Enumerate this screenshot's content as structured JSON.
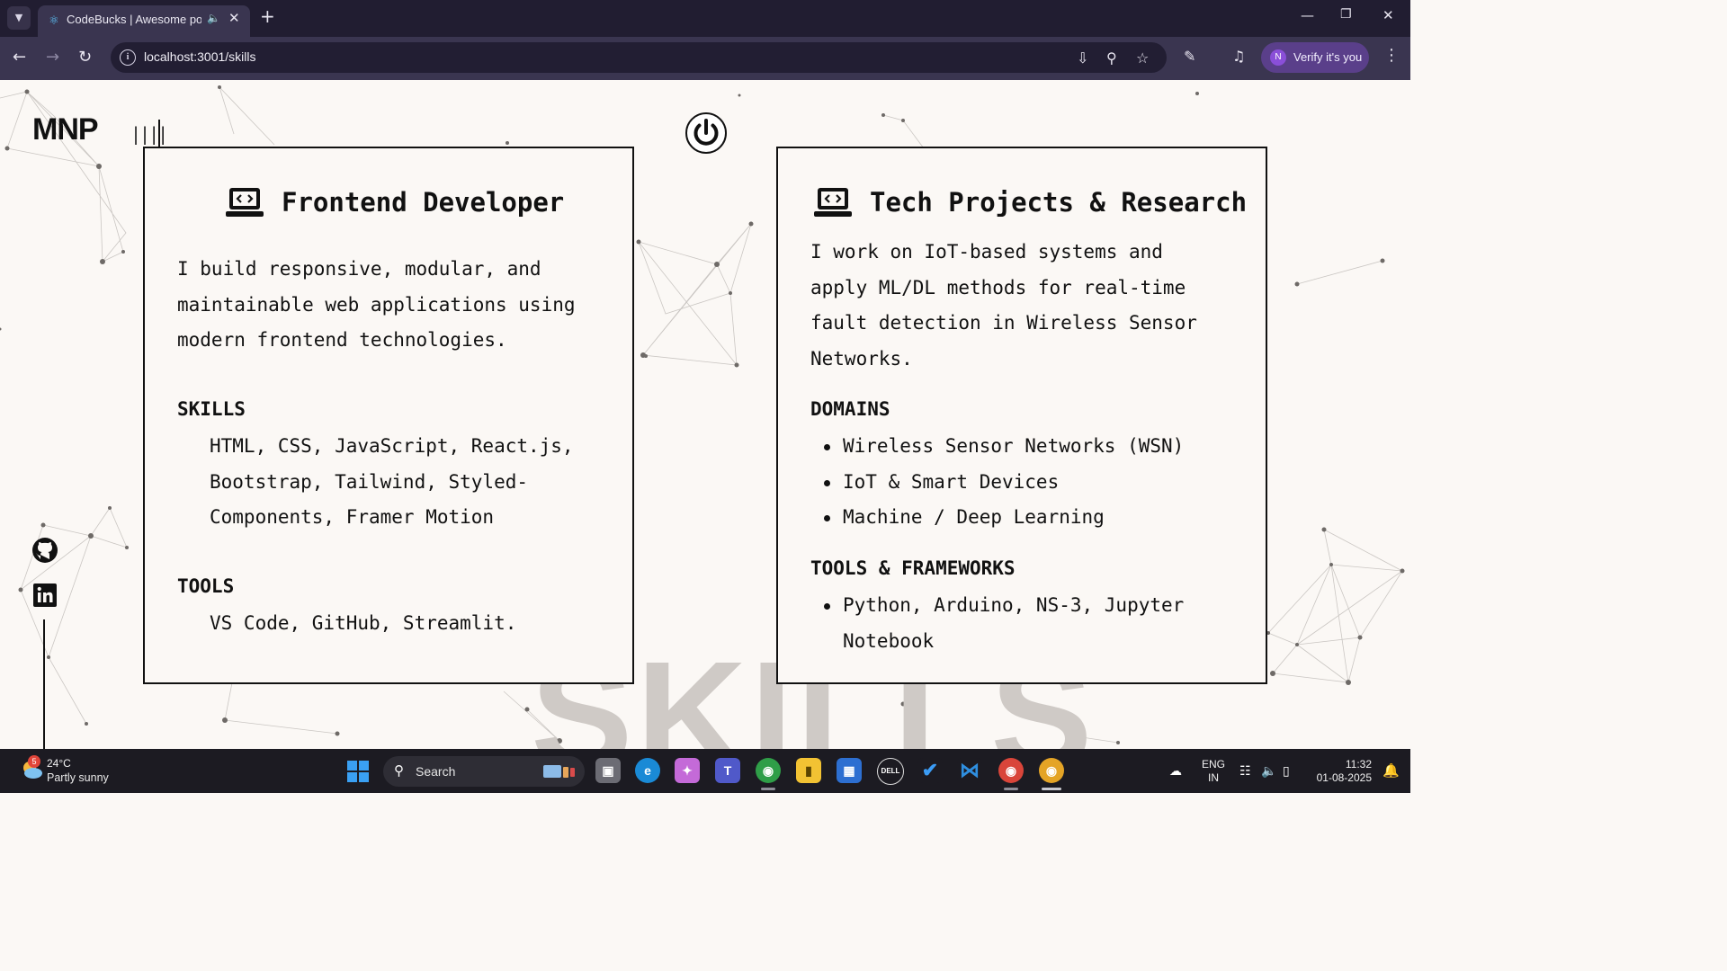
{
  "browser": {
    "tab_title": "CodeBucks | Awesome portfolio website",
    "url": "localhost:3001/skills",
    "profile_button": "Verify it's you",
    "profile_initial": "N"
  },
  "site": {
    "logo": "MNP",
    "menu_bars": "||||",
    "background_word": "SKILLS"
  },
  "cards": {
    "frontend": {
      "title": "Frontend Developer",
      "intro": [
        "I build responsive, modular, and",
        "maintainable web applications using",
        "modern frontend technologies."
      ],
      "skills_label": "SKILLS",
      "skills": [
        "HTML, CSS, JavaScript, React.js,",
        "Bootstrap, Tailwind, Styled-",
        "Components, Framer Motion"
      ],
      "tools_label": "TOOLS",
      "tools": "VS Code, GitHub, Streamlit."
    },
    "research": {
      "title": "Tech Projects & Research",
      "intro": [
        "I work on IoT-based systems and",
        "apply ML/DL methods for real-time",
        "fault detection in Wireless Sensor",
        "Networks."
      ],
      "domains_label": "DOMAINS",
      "domains": [
        "Wireless Sensor Networks (WSN)",
        "IoT & Smart Devices",
        "Machine / Deep Learning"
      ],
      "tools_label": "TOOLS & FRAMEWORKS",
      "tools": [
        "Python, Arduino, NS-3, Jupyter",
        "Notebook"
      ]
    }
  },
  "taskbar": {
    "weather_temp": "24°C",
    "weather_cond": "Partly sunny",
    "weather_badge": "5",
    "search_label": "Search",
    "lang_top": "ENG",
    "lang_bottom": "IN",
    "time": "11:32",
    "date": "01-08-2025"
  },
  "colors": {
    "card_border": "#111111",
    "page_bg": "#fbf8f5",
    "background_word": "#cfcac6",
    "tab_bar": "#211d31",
    "toolbar": "#3a3550",
    "profile_button": "#5a3f8a"
  }
}
